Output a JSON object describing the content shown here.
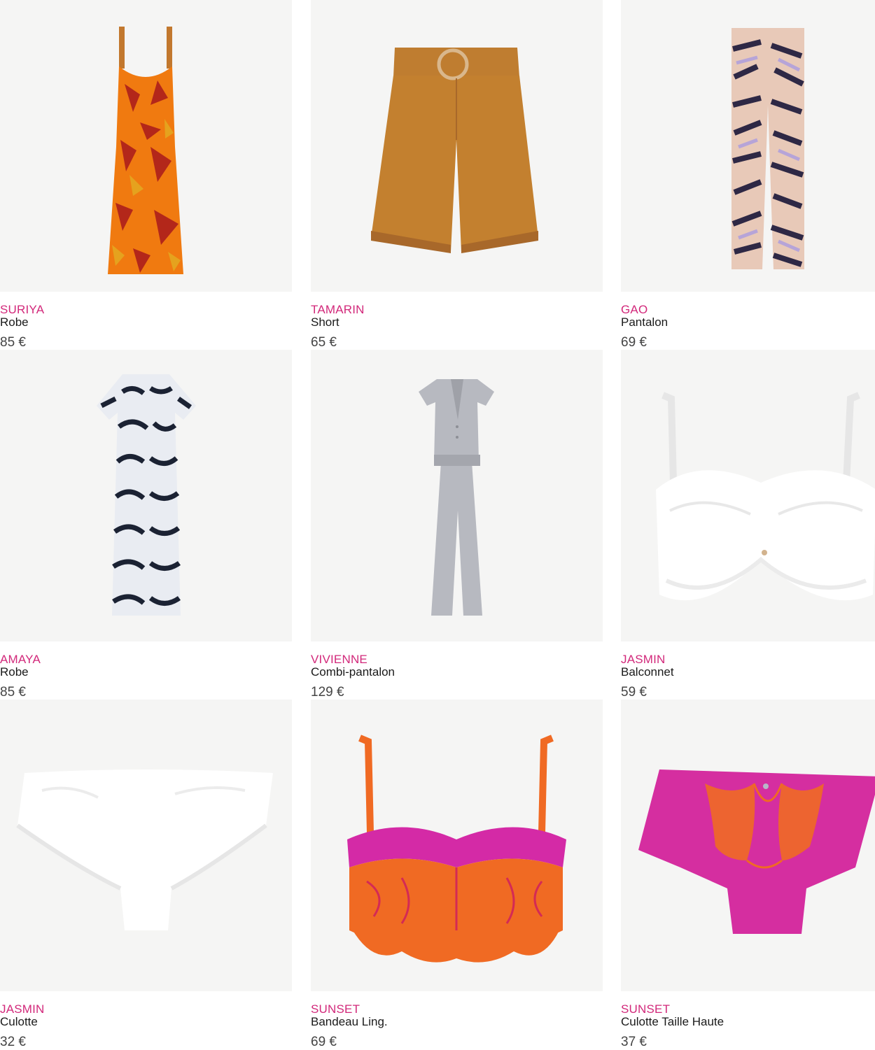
{
  "colors": {
    "brand_accent": "#d2287a",
    "tile_background": "#f5f5f4",
    "text": "#1a1a1a",
    "price": "#444444"
  },
  "products": [
    {
      "brand": "SURIYA",
      "type": "Robe",
      "price": "85 €",
      "image_icon": "orange-print-maxi-dress-image"
    },
    {
      "brand": "TAMARIN",
      "type": "Short",
      "price": "65 €",
      "image_icon": "camel-belted-shorts-image"
    },
    {
      "brand": "GAO",
      "type": "Pantalon",
      "price": "69 €",
      "image_icon": "zebra-print-pants-image"
    },
    {
      "brand": "AMAYA",
      "type": "Robe",
      "price": "85 €",
      "image_icon": "black-white-print-dress-image"
    },
    {
      "brand": "VIVIENNE",
      "type": "Combi-pantalon",
      "price": "129 €",
      "image_icon": "grey-satin-jumpsuit-image"
    },
    {
      "brand": "JASMIN",
      "type": "Balconnet",
      "price": "59 €",
      "image_icon": "white-lace-bra-image"
    },
    {
      "brand": "JASMIN",
      "type": "Culotte",
      "price": "32 €",
      "image_icon": "white-lace-brief-image"
    },
    {
      "brand": "SUNSET",
      "type": "Bandeau Ling.",
      "price": "69 €",
      "image_icon": "orange-pink-bandeau-bra-image"
    },
    {
      "brand": "SUNSET",
      "type": "Culotte Taille Haute",
      "price": "37 €",
      "image_icon": "pink-orange-high-waist-brief-image"
    }
  ]
}
